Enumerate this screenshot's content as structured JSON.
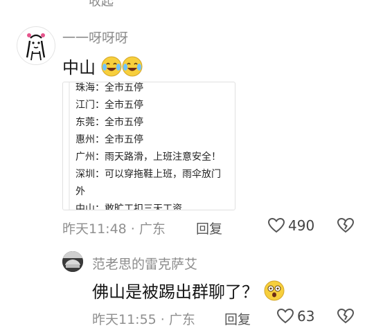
{
  "top_partial_text": "收起",
  "comment1": {
    "username": "一一呀呀呀",
    "text": "中山",
    "emoji_count": 2,
    "image_lines": [
      {
        "city": "珠海：",
        "text": "全市五停"
      },
      {
        "city": "江门：",
        "text": "全市五停"
      },
      {
        "city": "东莞：",
        "text": "全市五停"
      },
      {
        "city": "惠州：",
        "text": "全市五停"
      },
      {
        "city": "广州：",
        "text": "雨天路滑，上班注意安全！"
      },
      {
        "city": "深圳：",
        "text": "可以穿拖鞋上班，雨伞放门"
      },
      {
        "city": "",
        "text": "外"
      },
      {
        "city": "中山：",
        "text": "敢旷工扣三天工资"
      }
    ],
    "time": "昨天11:48",
    "location": "广东",
    "reply_label": "回复",
    "likes": "490"
  },
  "comment2": {
    "username": "范老思的雷克萨艾",
    "text": "佛山是被踢出群聊了？",
    "time": "昨天11:55",
    "location": "广东",
    "reply_label": "回复",
    "likes": "63"
  },
  "colors": {
    "like_icon": "#555555",
    "meta_gray": "#8f8f8f"
  },
  "icons": {
    "like": "heart-icon",
    "dislike": "broken-heart-icon"
  }
}
